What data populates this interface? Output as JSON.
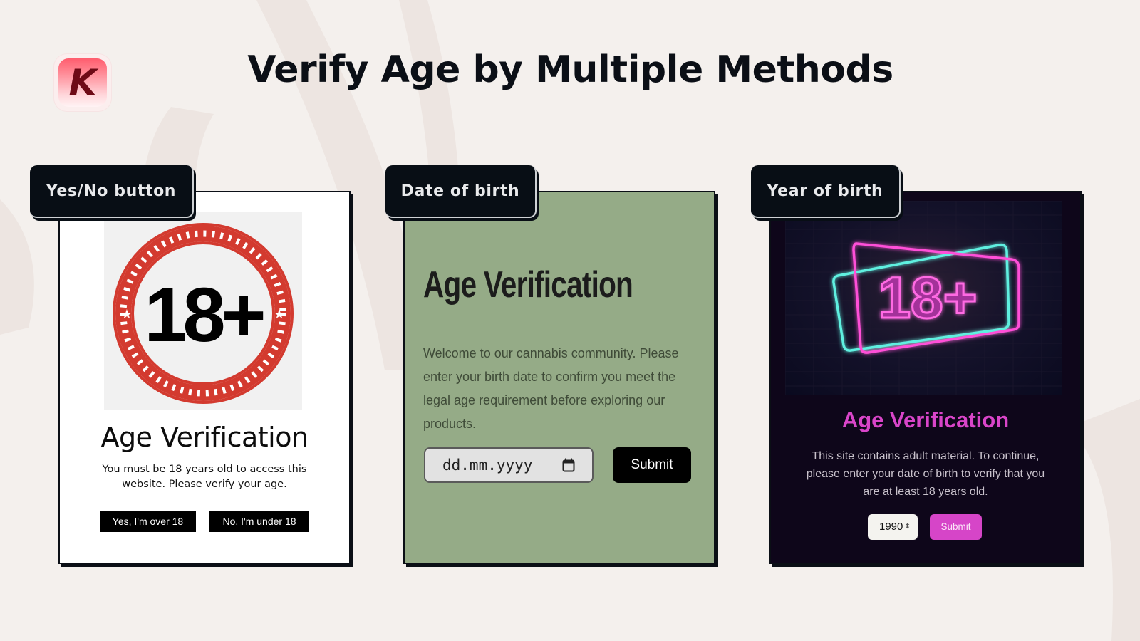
{
  "header": {
    "logo_letter": "K",
    "title": "Verify Age by Multiple Methods"
  },
  "colors": {
    "background": "#f4f0ed",
    "tag_bg": "#080e15",
    "card2_bg": "#95ab87",
    "card3_bg": "#0e061a",
    "accent_pink": "#d645c8",
    "badge_red": "#d33a2f",
    "neon_pink": "#ff4fd8",
    "neon_cyan": "#5ff0e0"
  },
  "methods": [
    {
      "tag": "Yes/No button",
      "badge_text": "18+",
      "title": "Age Verification",
      "body": "You must be 18 years old to access this website. Please verify your age.",
      "yes_label": "Yes, I'm over 18",
      "no_label": "No, I'm under 18"
    },
    {
      "tag": "Date of birth",
      "title": "Age Verification",
      "body": "Welcome to our cannabis community. Please enter your birth date to confirm you meet the legal age requirement before exploring our products.",
      "date_placeholder": "dd.mm.yyyy",
      "submit_label": "Submit"
    },
    {
      "tag": "Year of birth",
      "badge_text": "18+",
      "title": "Age Verification",
      "body": "This site contains adult material. To continue, please enter your date of birth to verify that you are at least 18 years old.",
      "year_value": "1990",
      "spinner_glyph": "⬍",
      "submit_label": "Submit"
    }
  ]
}
